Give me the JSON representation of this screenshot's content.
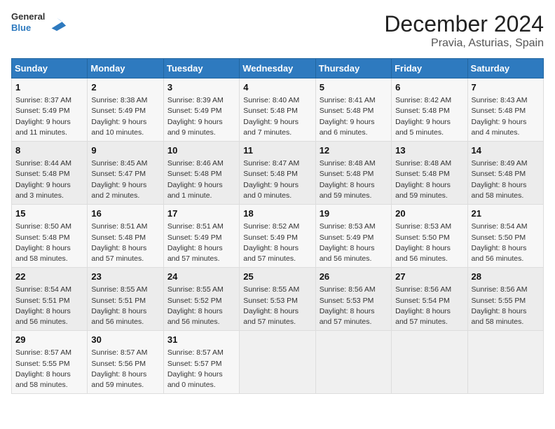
{
  "header": {
    "logo_line1": "General",
    "logo_line2": "Blue",
    "title": "December 2024",
    "subtitle": "Pravia, Asturias, Spain"
  },
  "days_of_week": [
    "Sunday",
    "Monday",
    "Tuesday",
    "Wednesday",
    "Thursday",
    "Friday",
    "Saturday"
  ],
  "weeks": [
    [
      {
        "day": "1",
        "info": "Sunrise: 8:37 AM\nSunset: 5:49 PM\nDaylight: 9 hours and 11 minutes."
      },
      {
        "day": "2",
        "info": "Sunrise: 8:38 AM\nSunset: 5:49 PM\nDaylight: 9 hours and 10 minutes."
      },
      {
        "day": "3",
        "info": "Sunrise: 8:39 AM\nSunset: 5:49 PM\nDaylight: 9 hours and 9 minutes."
      },
      {
        "day": "4",
        "info": "Sunrise: 8:40 AM\nSunset: 5:48 PM\nDaylight: 9 hours and 7 minutes."
      },
      {
        "day": "5",
        "info": "Sunrise: 8:41 AM\nSunset: 5:48 PM\nDaylight: 9 hours and 6 minutes."
      },
      {
        "day": "6",
        "info": "Sunrise: 8:42 AM\nSunset: 5:48 PM\nDaylight: 9 hours and 5 minutes."
      },
      {
        "day": "7",
        "info": "Sunrise: 8:43 AM\nSunset: 5:48 PM\nDaylight: 9 hours and 4 minutes."
      }
    ],
    [
      {
        "day": "8",
        "info": "Sunrise: 8:44 AM\nSunset: 5:48 PM\nDaylight: 9 hours and 3 minutes."
      },
      {
        "day": "9",
        "info": "Sunrise: 8:45 AM\nSunset: 5:47 PM\nDaylight: 9 hours and 2 minutes."
      },
      {
        "day": "10",
        "info": "Sunrise: 8:46 AM\nSunset: 5:48 PM\nDaylight: 9 hours and 1 minute."
      },
      {
        "day": "11",
        "info": "Sunrise: 8:47 AM\nSunset: 5:48 PM\nDaylight: 9 hours and 0 minutes."
      },
      {
        "day": "12",
        "info": "Sunrise: 8:48 AM\nSunset: 5:48 PM\nDaylight: 8 hours and 59 minutes."
      },
      {
        "day": "13",
        "info": "Sunrise: 8:48 AM\nSunset: 5:48 PM\nDaylight: 8 hours and 59 minutes."
      },
      {
        "day": "14",
        "info": "Sunrise: 8:49 AM\nSunset: 5:48 PM\nDaylight: 8 hours and 58 minutes."
      }
    ],
    [
      {
        "day": "15",
        "info": "Sunrise: 8:50 AM\nSunset: 5:48 PM\nDaylight: 8 hours and 58 minutes."
      },
      {
        "day": "16",
        "info": "Sunrise: 8:51 AM\nSunset: 5:48 PM\nDaylight: 8 hours and 57 minutes."
      },
      {
        "day": "17",
        "info": "Sunrise: 8:51 AM\nSunset: 5:49 PM\nDaylight: 8 hours and 57 minutes."
      },
      {
        "day": "18",
        "info": "Sunrise: 8:52 AM\nSunset: 5:49 PM\nDaylight: 8 hours and 57 minutes."
      },
      {
        "day": "19",
        "info": "Sunrise: 8:53 AM\nSunset: 5:49 PM\nDaylight: 8 hours and 56 minutes."
      },
      {
        "day": "20",
        "info": "Sunrise: 8:53 AM\nSunset: 5:50 PM\nDaylight: 8 hours and 56 minutes."
      },
      {
        "day": "21",
        "info": "Sunrise: 8:54 AM\nSunset: 5:50 PM\nDaylight: 8 hours and 56 minutes."
      }
    ],
    [
      {
        "day": "22",
        "info": "Sunrise: 8:54 AM\nSunset: 5:51 PM\nDaylight: 8 hours and 56 minutes."
      },
      {
        "day": "23",
        "info": "Sunrise: 8:55 AM\nSunset: 5:51 PM\nDaylight: 8 hours and 56 minutes."
      },
      {
        "day": "24",
        "info": "Sunrise: 8:55 AM\nSunset: 5:52 PM\nDaylight: 8 hours and 56 minutes."
      },
      {
        "day": "25",
        "info": "Sunrise: 8:55 AM\nSunset: 5:53 PM\nDaylight: 8 hours and 57 minutes."
      },
      {
        "day": "26",
        "info": "Sunrise: 8:56 AM\nSunset: 5:53 PM\nDaylight: 8 hours and 57 minutes."
      },
      {
        "day": "27",
        "info": "Sunrise: 8:56 AM\nSunset: 5:54 PM\nDaylight: 8 hours and 57 minutes."
      },
      {
        "day": "28",
        "info": "Sunrise: 8:56 AM\nSunset: 5:55 PM\nDaylight: 8 hours and 58 minutes."
      }
    ],
    [
      {
        "day": "29",
        "info": "Sunrise: 8:57 AM\nSunset: 5:55 PM\nDaylight: 8 hours and 58 minutes."
      },
      {
        "day": "30",
        "info": "Sunrise: 8:57 AM\nSunset: 5:56 PM\nDaylight: 8 hours and 59 minutes."
      },
      {
        "day": "31",
        "info": "Sunrise: 8:57 AM\nSunset: 5:57 PM\nDaylight: 9 hours and 0 minutes."
      },
      null,
      null,
      null,
      null
    ]
  ]
}
